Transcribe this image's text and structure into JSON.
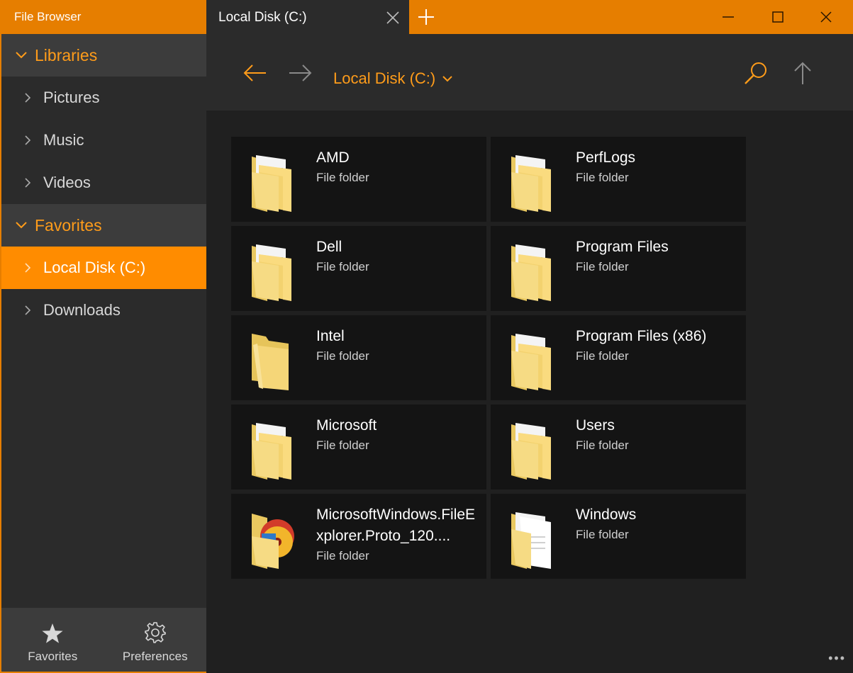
{
  "app": {
    "title": "File Browser"
  },
  "colors": {
    "accent": "#ff8c00",
    "accent_text": "#ff9c1a",
    "titlebar": "#e67e00"
  },
  "tab": {
    "title": "Local Disk (C:)"
  },
  "sidebar": {
    "libraries": {
      "label": "Libraries",
      "items": [
        {
          "label": "Pictures"
        },
        {
          "label": "Music"
        },
        {
          "label": "Videos"
        }
      ]
    },
    "favorites": {
      "label": "Favorites",
      "items": [
        {
          "label": "Local Disk (C:)",
          "selected": true
        },
        {
          "label": "Downloads"
        }
      ]
    },
    "bottom": {
      "favorites_label": "Favorites",
      "preferences_label": "Preferences"
    }
  },
  "toolbar": {
    "location": "Local Disk (C:)"
  },
  "folders": [
    {
      "name": "AMD",
      "type": "File folder",
      "icon": "folder-documents-icon"
    },
    {
      "name": "PerfLogs",
      "type": "File folder",
      "icon": "folder-documents-icon"
    },
    {
      "name": "Dell",
      "type": "File folder",
      "icon": "folder-documents-icon"
    },
    {
      "name": "Program Files",
      "type": "File folder",
      "icon": "folder-documents-icon"
    },
    {
      "name": "Intel",
      "type": "File folder",
      "icon": "folder-empty-icon"
    },
    {
      "name": "Program Files (x86)",
      "type": "File folder",
      "icon": "folder-documents-icon"
    },
    {
      "name": "Microsoft",
      "type": "File folder",
      "icon": "folder-documents-icon"
    },
    {
      "name": "Users",
      "type": "File folder",
      "icon": "folder-documents-icon"
    },
    {
      "name": "MicrosoftWindows.FileExplorer.Proto_120....",
      "type": "File folder",
      "icon": "folder-media-icon"
    },
    {
      "name": "Windows",
      "type": "File folder",
      "icon": "folder-white-documents-icon"
    }
  ]
}
